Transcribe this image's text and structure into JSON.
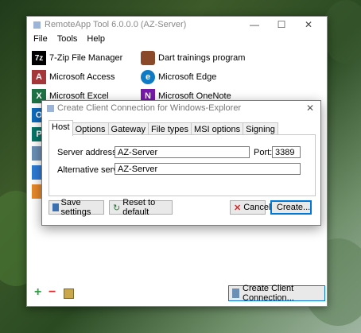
{
  "window": {
    "title": "RemoteApp Tool 6.0.0.0 (AZ-Server)",
    "minimize_glyph": "—",
    "maximize_glyph": "☐",
    "close_glyph": "✕"
  },
  "menu": [
    "File",
    "Tools",
    "Help"
  ],
  "apps": [
    {
      "label": "7-Zip File Manager",
      "icon": "7zip-icon",
      "glyph": "7z",
      "color": "#000000"
    },
    {
      "label": "Dart trainings program",
      "icon": "dart-icon",
      "glyph": "",
      "color": "#8a4a2a"
    },
    {
      "label": "Microsoft Access",
      "icon": "access-icon",
      "glyph": "A",
      "color": "#a4373a"
    },
    {
      "label": "Microsoft Edge",
      "icon": "edge-icon",
      "glyph": "e",
      "color": "#0f7bc4"
    },
    {
      "label": "Microsoft Excel",
      "icon": "excel-icon",
      "glyph": "X",
      "color": "#1e7145"
    },
    {
      "label": "Microsoft OneNote",
      "icon": "onenote-icon",
      "glyph": "N",
      "color": "#7719aa"
    }
  ],
  "partial_app_icons": [
    {
      "icon": "outlook-icon",
      "glyph": "O",
      "color": "#0f6cbd"
    },
    {
      "icon": "publisher-icon",
      "glyph": "P",
      "color": "#077568"
    },
    {
      "icon": "app-icon",
      "glyph": "",
      "color": "#6b8fb5"
    },
    {
      "icon": "app-icon",
      "glyph": "",
      "color": "#2e7bd6"
    },
    {
      "icon": "app-icon",
      "glyph": "",
      "color": "#e8892b"
    }
  ],
  "dialog": {
    "title": "Create Client Connection for Windows-Explorer",
    "close_glyph": "✕",
    "tabs": [
      "Host",
      "Options",
      "Gateway",
      "File types",
      "MSI options",
      "Signing"
    ],
    "active_tab": "Host",
    "server_address_label": "Server address:",
    "server_address_value": "AZ-Server",
    "port_label": "Port:",
    "port_value": "3389",
    "alt_server_label": "Alternative server:",
    "alt_server_value": "AZ-Server",
    "save_settings": "Save settings",
    "reset_default": "Reset to default",
    "cancel": "Cancel",
    "create": "Create..."
  },
  "bottom": {
    "add_glyph": "+",
    "remove_glyph": "−",
    "create_client_connection": "Create Client Connection..."
  }
}
